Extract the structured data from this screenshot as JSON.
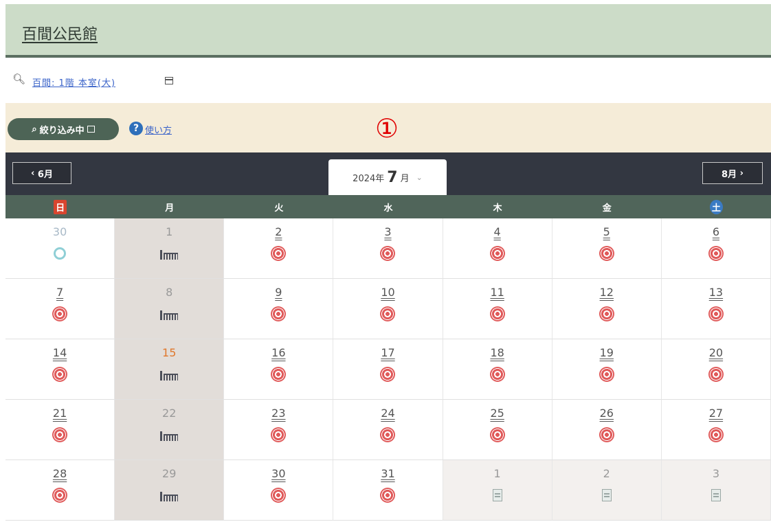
{
  "facility_name": "百間公民館",
  "filter": {
    "facility_link": "百間: 1階 本室(大)"
  },
  "actions": {
    "narrow_label": "絞り込み中",
    "help_label": "使い方",
    "annotation_marker": "①"
  },
  "calendar": {
    "prev_label": "6月",
    "next_label": "8月",
    "year_label": "2024年",
    "month_num": "7",
    "month_suffix": "月",
    "weekdays": [
      "日",
      "月",
      "火",
      "水",
      "木",
      "金",
      "土"
    ],
    "weeks": [
      [
        {
          "day": "30",
          "icon": "ring-icon",
          "style": "faded",
          "mon": false,
          "out": false
        },
        {
          "day": "1",
          "icon": "closed-icon",
          "style": "gray",
          "mon": true,
          "out": false
        },
        {
          "day": "2",
          "icon": "target-icon",
          "style": "link",
          "mon": false,
          "out": false
        },
        {
          "day": "3",
          "icon": "target-icon",
          "style": "link",
          "mon": false,
          "out": false
        },
        {
          "day": "4",
          "icon": "target-icon",
          "style": "link",
          "mon": false,
          "out": false
        },
        {
          "day": "5",
          "icon": "target-icon",
          "style": "link",
          "mon": false,
          "out": false
        },
        {
          "day": "6",
          "icon": "target-icon",
          "style": "link",
          "mon": false,
          "out": false
        }
      ],
      [
        {
          "day": "7",
          "icon": "target-icon",
          "style": "link",
          "mon": false,
          "out": false
        },
        {
          "day": "8",
          "icon": "closed-icon",
          "style": "gray",
          "mon": true,
          "out": false
        },
        {
          "day": "9",
          "icon": "target-icon",
          "style": "link",
          "mon": false,
          "out": false
        },
        {
          "day": "10",
          "icon": "target-icon",
          "style": "link",
          "mon": false,
          "out": false
        },
        {
          "day": "11",
          "icon": "target-icon",
          "style": "link",
          "mon": false,
          "out": false
        },
        {
          "day": "12",
          "icon": "target-icon",
          "style": "link",
          "mon": false,
          "out": false
        },
        {
          "day": "13",
          "icon": "target-icon",
          "style": "link",
          "mon": false,
          "out": false
        }
      ],
      [
        {
          "day": "14",
          "icon": "target-icon",
          "style": "link",
          "mon": false,
          "out": false
        },
        {
          "day": "15",
          "icon": "closed-icon",
          "style": "red",
          "mon": true,
          "out": false
        },
        {
          "day": "16",
          "icon": "target-icon",
          "style": "link",
          "mon": false,
          "out": false
        },
        {
          "day": "17",
          "icon": "target-icon",
          "style": "link",
          "mon": false,
          "out": false
        },
        {
          "day": "18",
          "icon": "target-icon",
          "style": "link",
          "mon": false,
          "out": false
        },
        {
          "day": "19",
          "icon": "target-icon",
          "style": "link",
          "mon": false,
          "out": false
        },
        {
          "day": "20",
          "icon": "target-icon",
          "style": "link",
          "mon": false,
          "out": false
        }
      ],
      [
        {
          "day": "21",
          "icon": "target-icon",
          "style": "link",
          "mon": false,
          "out": false
        },
        {
          "day": "22",
          "icon": "closed-icon",
          "style": "gray",
          "mon": true,
          "out": false
        },
        {
          "day": "23",
          "icon": "target-icon",
          "style": "link",
          "mon": false,
          "out": false
        },
        {
          "day": "24",
          "icon": "target-icon",
          "style": "link",
          "mon": false,
          "out": false
        },
        {
          "day": "25",
          "icon": "target-icon",
          "style": "link",
          "mon": false,
          "out": false
        },
        {
          "day": "26",
          "icon": "target-icon",
          "style": "link",
          "mon": false,
          "out": false
        },
        {
          "day": "27",
          "icon": "target-icon",
          "style": "link",
          "mon": false,
          "out": false
        }
      ],
      [
        {
          "day": "28",
          "icon": "target-icon",
          "style": "link",
          "mon": false,
          "out": false
        },
        {
          "day": "29",
          "icon": "closed-icon",
          "style": "gray",
          "mon": true,
          "out": false
        },
        {
          "day": "30",
          "icon": "target-icon",
          "style": "link",
          "mon": false,
          "out": false
        },
        {
          "day": "31",
          "icon": "target-icon",
          "style": "link",
          "mon": false,
          "out": false
        },
        {
          "day": "1",
          "icon": "doc-icon",
          "style": "gray",
          "mon": false,
          "out": true
        },
        {
          "day": "2",
          "icon": "doc-icon",
          "style": "gray",
          "mon": false,
          "out": true
        },
        {
          "day": "3",
          "icon": "doc-icon",
          "style": "gray",
          "mon": false,
          "out": true
        }
      ]
    ]
  }
}
